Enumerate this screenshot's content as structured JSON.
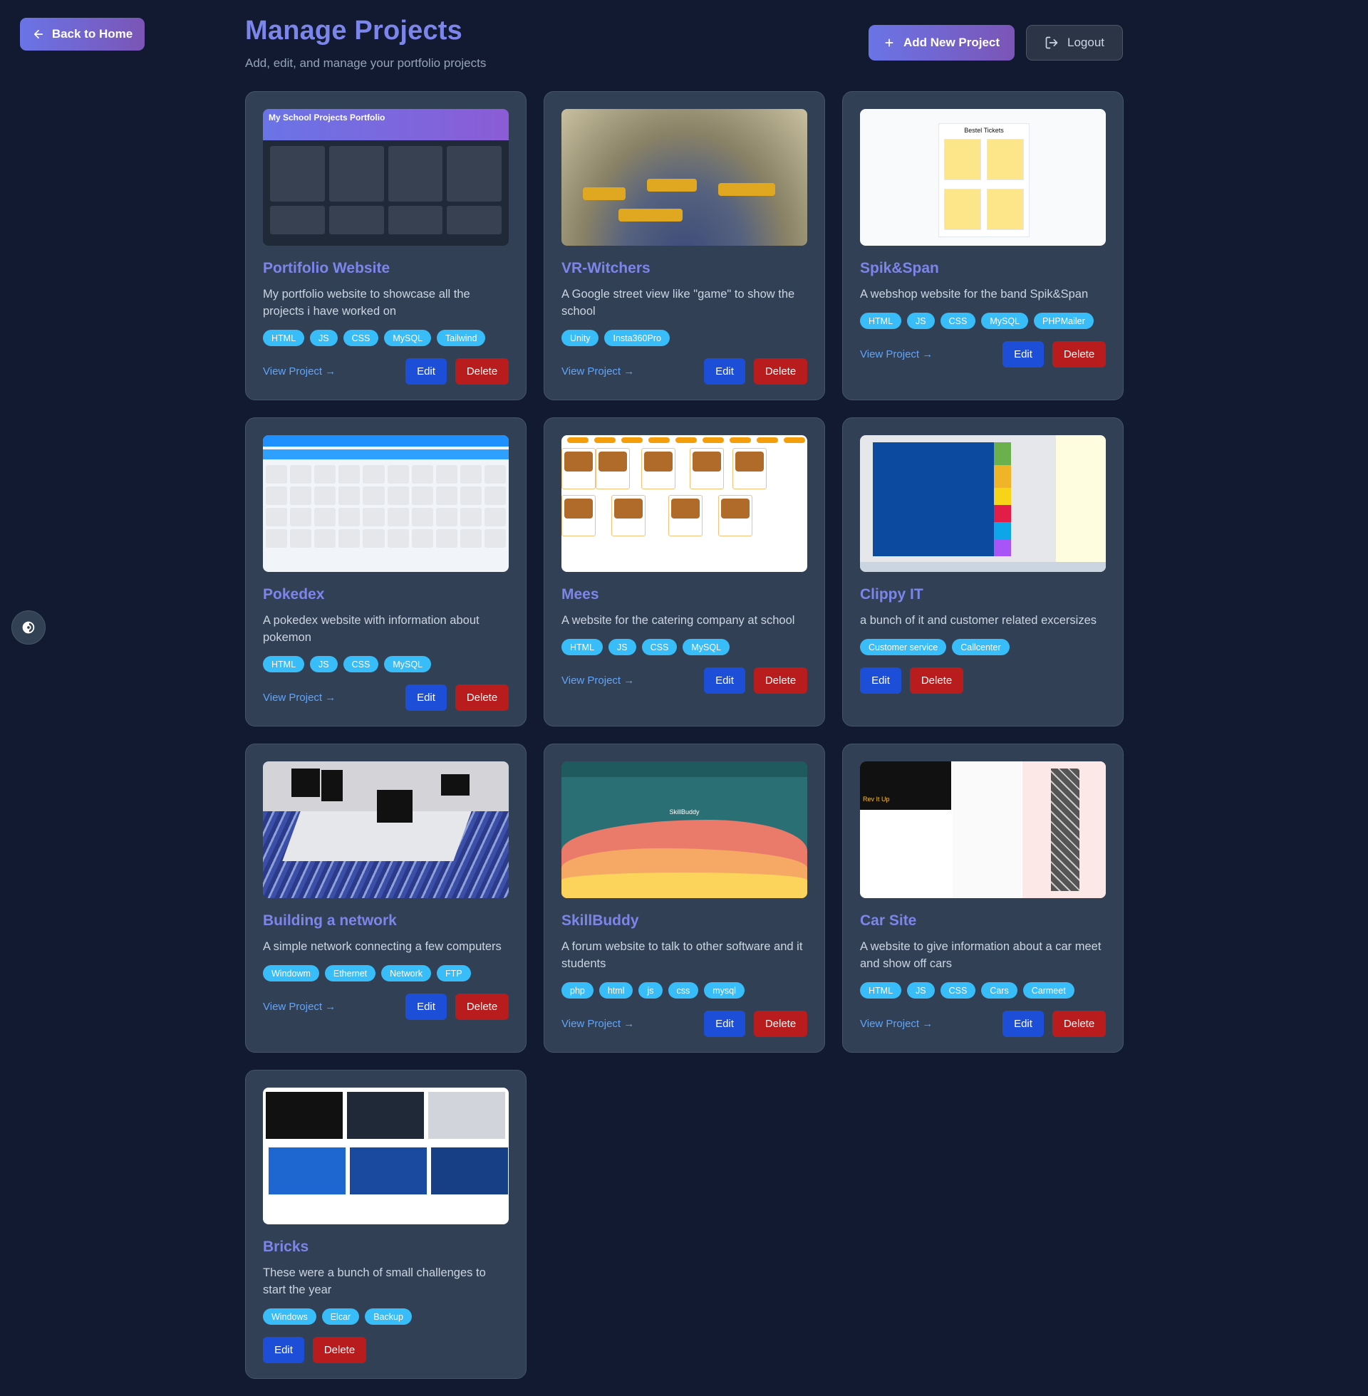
{
  "nav": {
    "back_label": "Back to Home"
  },
  "header": {
    "title": "Manage Projects",
    "subtitle": "Add, edit, and manage your portfolio projects",
    "add_label": "Add New Project",
    "logout_label": "Logout"
  },
  "labels": {
    "view": "View Project →",
    "edit": "Edit",
    "delete": "Delete"
  },
  "thumb_text": {
    "portfolio_heading": "My School Projects Portfolio",
    "spik_heading": "Bestel Tickets",
    "skill_heading": "SkillBuddy",
    "car_heading": "Rev It Up"
  },
  "projects": [
    {
      "title": "Portifolio Website",
      "description": "My portfolio website to showcase all the projects i have worked on",
      "tags": [
        "HTML",
        "JS",
        "CSS",
        "MySQL",
        "Tailwind"
      ],
      "has_link": true
    },
    {
      "title": "VR-Witchers",
      "description": "A Google street view like \"game\" to show the school",
      "tags": [
        "Unity",
        "Insta360Pro"
      ],
      "has_link": true
    },
    {
      "title": "Spik&Span",
      "description": "A webshop website for the band Spik&Span",
      "tags": [
        "HTML",
        "JS",
        "CSS",
        "MySQL",
        "PHPMailer"
      ],
      "has_link": true
    },
    {
      "title": "Pokedex",
      "description": "A pokedex website with information about pokemon",
      "tags": [
        "HTML",
        "JS",
        "CSS",
        "MySQL"
      ],
      "has_link": true
    },
    {
      "title": "Mees",
      "description": "A website for the catering company at school",
      "tags": [
        "HTML",
        "JS",
        "CSS",
        "MySQL"
      ],
      "has_link": true
    },
    {
      "title": "Clippy IT",
      "description": "a bunch of it and customer related excersizes",
      "tags": [
        "Customer service",
        "Callcenter"
      ],
      "has_link": false
    },
    {
      "title": "Building a network",
      "description": "A simple network connecting a few computers",
      "tags": [
        "Windowm",
        "Ethernet",
        "Network",
        "FTP"
      ],
      "has_link": true
    },
    {
      "title": "SkillBuddy",
      "description": "A forum website to talk to other software and it students",
      "tags": [
        "php",
        "html",
        "js",
        "css",
        "mysql"
      ],
      "has_link": true
    },
    {
      "title": "Car Site",
      "description": "A website to give information about a car meet and show off cars",
      "tags": [
        "HTML",
        "JS",
        "CSS",
        "Cars",
        "Carmeet"
      ],
      "has_link": true
    },
    {
      "title": "Bricks",
      "description": "These were a bunch of small challenges to start the year",
      "tags": [
        "Windows",
        "Elcar",
        "Backup"
      ],
      "has_link": false
    }
  ]
}
